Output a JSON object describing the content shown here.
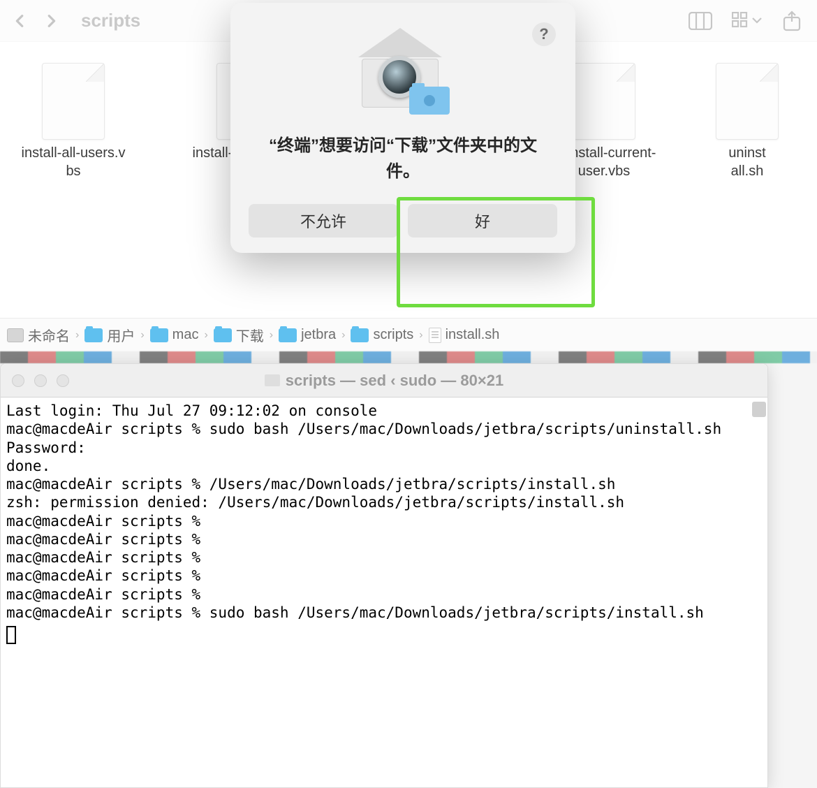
{
  "finder": {
    "title": "scripts",
    "files": [
      {
        "name": "install-all-users.vbs"
      },
      {
        "name": "install-current-user.vbs"
      },
      {
        "name": "uninstall-current-user.vbs"
      },
      {
        "name": "uninstall.sh"
      }
    ],
    "pathbar": [
      {
        "icon": "disk",
        "label": "未命名"
      },
      {
        "icon": "folder",
        "label": "用户"
      },
      {
        "icon": "folder",
        "label": "mac"
      },
      {
        "icon": "folder",
        "label": "下载"
      },
      {
        "icon": "folder",
        "label": "jetbra"
      },
      {
        "icon": "folder",
        "label": "scripts"
      },
      {
        "icon": "doc",
        "label": "install.sh"
      }
    ]
  },
  "dialog": {
    "message": "“终端”想要访问“下载”文件夹中的文件。",
    "deny": "不允许",
    "allow": "好",
    "help_tooltip": "?"
  },
  "terminal": {
    "title": "scripts — sed ‹ sudo — 80×21",
    "lines": [
      "Last login: Thu Jul 27 09:12:02 on console",
      "mac@macdeAir scripts % sudo bash /Users/mac/Downloads/jetbra/scripts/uninstall.sh",
      "Password:",
      "done.",
      "mac@macdeAir scripts % /Users/mac/Downloads/jetbra/scripts/install.sh",
      "zsh: permission denied: /Users/mac/Downloads/jetbra/scripts/install.sh",
      "mac@macdeAir scripts %",
      "mac@macdeAir scripts %",
      "mac@macdeAir scripts %",
      "mac@macdeAir scripts %",
      "mac@macdeAir scripts %",
      "mac@macdeAir scripts % sudo bash /Users/mac/Downloads/jetbra/scripts/install.sh"
    ]
  }
}
